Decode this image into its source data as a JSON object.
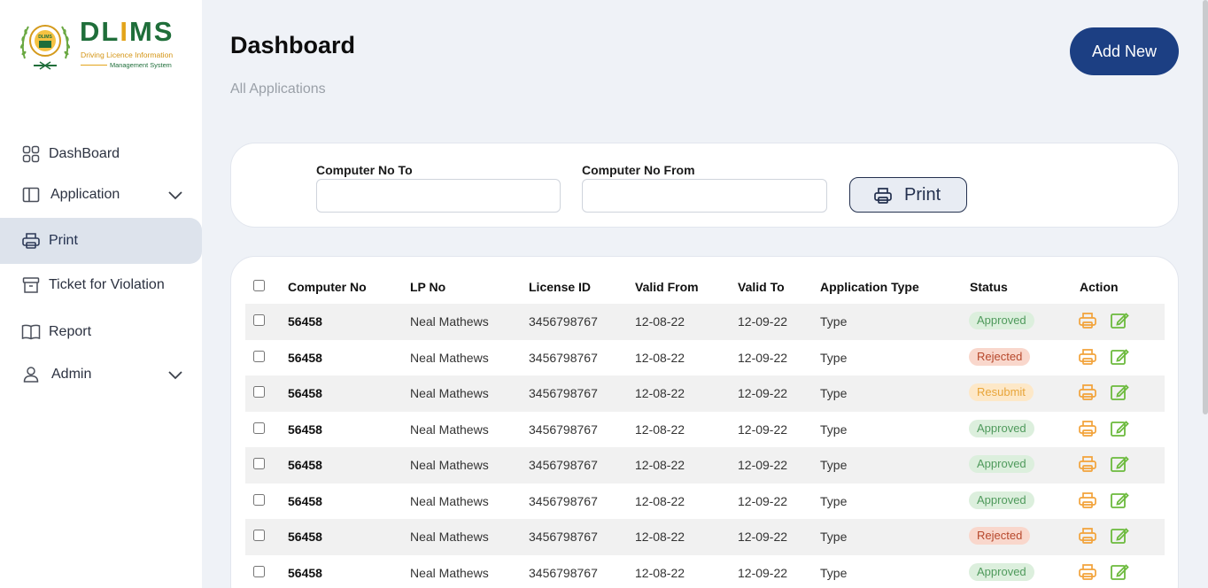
{
  "brand": {
    "name_prefix": "DL",
    "name_accent": "I",
    "name_suffix": "MS",
    "tagline_line1": "Driving Licence Information",
    "tagline_line2": "Management System",
    "emblem_text": "DLIMS"
  },
  "sidebar": {
    "items": [
      {
        "label": "DashBoard",
        "icon": "grid-icon",
        "has_chevron": false
      },
      {
        "label": "Application",
        "icon": "book-columns-icon",
        "has_chevron": true
      },
      {
        "label": "Print",
        "icon": "printer-icon",
        "has_chevron": false,
        "active": true
      },
      {
        "label": "Ticket for Violation",
        "icon": "archive-box-icon",
        "has_chevron": false
      },
      {
        "label": "Report",
        "icon": "open-book-icon",
        "has_chevron": false
      },
      {
        "label": "Admin",
        "icon": "user-icon",
        "has_chevron": true
      }
    ]
  },
  "header": {
    "title": "Dashboard",
    "subtitle": "All Applications",
    "add_new_label": "Add New"
  },
  "filter": {
    "computer_no_to_label": "Computer No To",
    "computer_no_to_value": "",
    "computer_no_from_label": "Computer No From",
    "computer_no_from_value": "",
    "print_label": "Print"
  },
  "table": {
    "columns": [
      "Computer No",
      "LP No",
      "License ID",
      "Valid From",
      "Valid To",
      "Application Type",
      "Status",
      "Action"
    ],
    "rows": [
      {
        "computer_no": "56458",
        "lp_no": "Neal Mathews",
        "license_id": "3456798767",
        "valid_from": "12-08-22",
        "valid_to": "12-09-22",
        "type": "Type",
        "status": "Approved"
      },
      {
        "computer_no": "56458",
        "lp_no": "Neal Mathews",
        "license_id": "3456798767",
        "valid_from": "12-08-22",
        "valid_to": "12-09-22",
        "type": "Type",
        "status": "Rejected"
      },
      {
        "computer_no": "56458",
        "lp_no": "Neal Mathews",
        "license_id": "3456798767",
        "valid_from": "12-08-22",
        "valid_to": "12-09-22",
        "type": "Type",
        "status": "Resubmit"
      },
      {
        "computer_no": "56458",
        "lp_no": "Neal Mathews",
        "license_id": "3456798767",
        "valid_from": "12-08-22",
        "valid_to": "12-09-22",
        "type": "Type",
        "status": "Approved"
      },
      {
        "computer_no": "56458",
        "lp_no": "Neal Mathews",
        "license_id": "3456798767",
        "valid_from": "12-08-22",
        "valid_to": "12-09-22",
        "type": "Type",
        "status": "Approved"
      },
      {
        "computer_no": "56458",
        "lp_no": "Neal Mathews",
        "license_id": "3456798767",
        "valid_from": "12-08-22",
        "valid_to": "12-09-22",
        "type": "Type",
        "status": "Approved"
      },
      {
        "computer_no": "56458",
        "lp_no": "Neal Mathews",
        "license_id": "3456798767",
        "valid_from": "12-08-22",
        "valid_to": "12-09-22",
        "type": "Type",
        "status": "Rejected"
      },
      {
        "computer_no": "56458",
        "lp_no": "Neal Mathews",
        "license_id": "3456798767",
        "valid_from": "12-08-22",
        "valid_to": "12-09-22",
        "type": "Type",
        "status": "Approved"
      }
    ]
  },
  "colors": {
    "primary": "#1c3f83",
    "brand_green": "#1f6e3a",
    "brand_gold": "#e3a41a",
    "action_print": "#f2a33a",
    "action_edit": "#6cba3d"
  }
}
